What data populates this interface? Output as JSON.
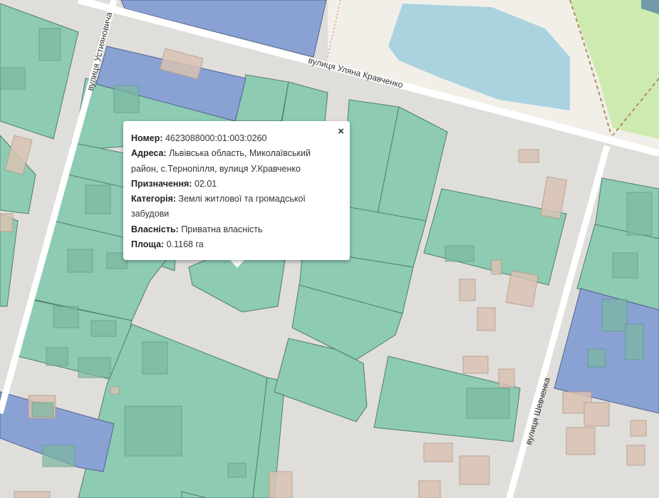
{
  "map": {
    "streets": [
      {
        "name": "вулиця Устияновича"
      },
      {
        "name": "вулиця Уляна Кравченко"
      },
      {
        "name": "вулиця Шевченка"
      }
    ],
    "colors": {
      "parcel_green": "#8dcbb3",
      "parcel_blue": "#8aa2d3",
      "building": "#d9c3b3",
      "road": "#ffffff",
      "background": "#e0dedb",
      "water": "#aad3df",
      "park": "#cdebb0",
      "landuse": "#f2efe9"
    }
  },
  "popup": {
    "close_label": "×",
    "fields": [
      {
        "label": "Номер:",
        "value": "4623088000:01:003:0260"
      },
      {
        "label": "Адреса:",
        "value": "Львівська область, Миколаївський район, с.Тернопілля, вулиця У.Кравченко"
      },
      {
        "label": "Призначення:",
        "value": "02.01"
      },
      {
        "label": "Категорія:",
        "value": "Землі житлової та громадської забудови"
      },
      {
        "label": "Власність:",
        "value": "Приватна власність"
      },
      {
        "label": "Площа:",
        "value": "0.1168 га"
      }
    ]
  }
}
